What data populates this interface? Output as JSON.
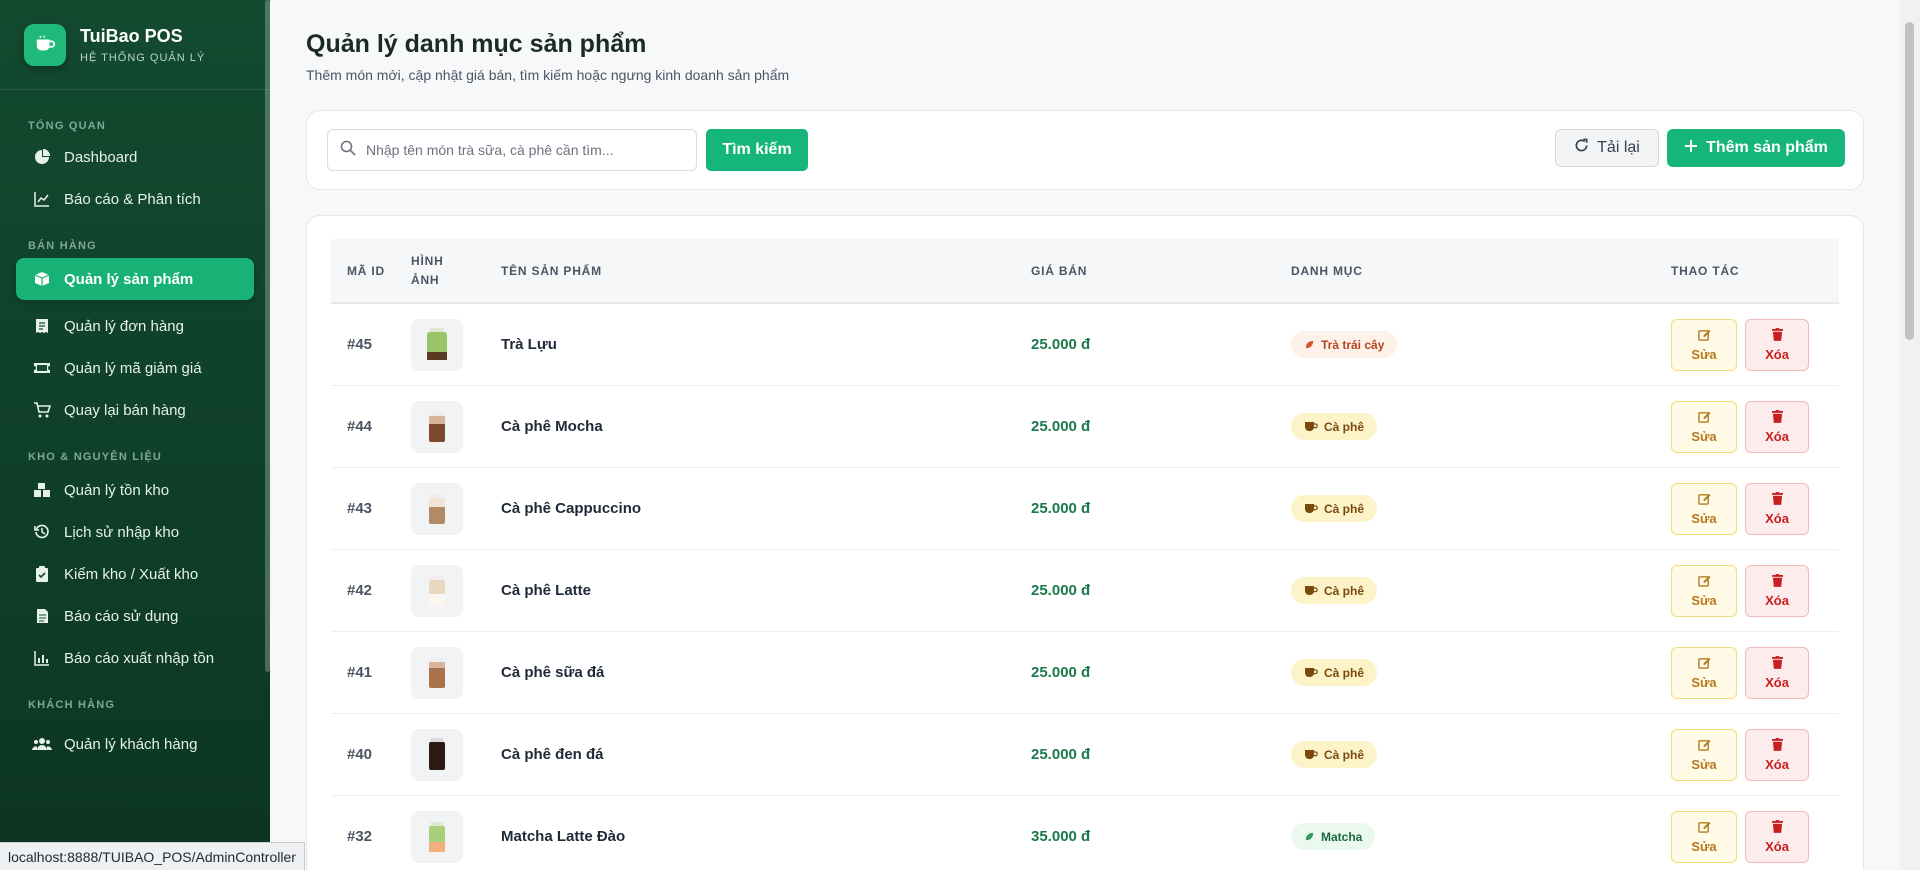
{
  "brand": {
    "name": "TuiBao POS",
    "subtitle": "HỆ THỐNG QUẢN LÝ"
  },
  "sidebar": {
    "sections": [
      {
        "title": "TỔNG QUAN",
        "items": [
          {
            "label": "Dashboard",
            "icon": "chart-pie-icon"
          },
          {
            "label": "Báo cáo & Phân tích",
            "icon": "chart-line-icon"
          }
        ]
      },
      {
        "title": "BÁN HÀNG",
        "items": [
          {
            "label": "Quản lý sản phẩm",
            "icon": "box-icon",
            "active": true
          },
          {
            "label": "Quản lý đơn hàng",
            "icon": "receipt-icon"
          },
          {
            "label": "Quản lý mã giảm giá",
            "icon": "ticket-icon"
          },
          {
            "label": "Quay lại bán hàng",
            "icon": "cart-icon"
          }
        ]
      },
      {
        "title": "KHO & NGUYÊN LIỆU",
        "items": [
          {
            "label": "Quản lý tồn kho",
            "icon": "boxes-icon"
          },
          {
            "label": "Lịch sử nhập kho",
            "icon": "history-icon"
          },
          {
            "label": "Kiểm kho / Xuất kho",
            "icon": "clipboard-check-icon"
          },
          {
            "label": "Báo cáo sử dụng",
            "icon": "file-icon"
          },
          {
            "label": "Báo cáo xuất nhập tồn",
            "icon": "bar-chart-icon"
          }
        ]
      },
      {
        "title": "KHÁCH HÀNG",
        "items": [
          {
            "label": "Quản lý khách hàng",
            "icon": "users-icon"
          }
        ]
      }
    ]
  },
  "page": {
    "title": "Quản lý danh mục sản phẩm",
    "subtitle": "Thêm món mới, cập nhật giá bán, tìm kiếm hoặc ngưng kinh doanh sản phẩm"
  },
  "toolbar": {
    "search_placeholder": "Nhập tên món trà sữa, cà phê cần tìm...",
    "search_value": "",
    "search_button": "Tìm kiếm",
    "reload_button": "Tải lại",
    "add_button": "Thêm sản phẩm"
  },
  "table": {
    "headers": {
      "id": "MÃ ID",
      "image_line1": "HÌNH",
      "image_line2": "ẢNH",
      "name": "TÊN SẢN PHẨM",
      "price": "GIÁ BÁN",
      "category": "DANH MỤC",
      "actions": "THAO TÁC"
    },
    "edit_label": "Sửa",
    "delete_label": "Xóa",
    "rows": [
      {
        "id": "#45",
        "name": "Trà Lựu",
        "price": "25.000 đ",
        "category": "Trà trái cây",
        "cat_type": "fruit",
        "drink": "green"
      },
      {
        "id": "#44",
        "name": "Cà phê Mocha",
        "price": "25.000 đ",
        "category": "Cà phê",
        "cat_type": "coffee",
        "drink": "mocha"
      },
      {
        "id": "#43",
        "name": "Cà phê Cappuccino",
        "price": "25.000 đ",
        "category": "Cà phê",
        "cat_type": "coffee",
        "drink": "cappuccino"
      },
      {
        "id": "#42",
        "name": "Cà phê Latte",
        "price": "25.000 đ",
        "category": "Cà phê",
        "cat_type": "coffee",
        "drink": "latte"
      },
      {
        "id": "#41",
        "name": "Cà phê sữa đá",
        "price": "25.000 đ",
        "category": "Cà phê",
        "cat_type": "coffee",
        "drink": "milkcoffee"
      },
      {
        "id": "#40",
        "name": "Cà phê đen đá",
        "price": "25.000 đ",
        "category": "Cà phê",
        "cat_type": "coffee",
        "drink": "black"
      },
      {
        "id": "#32",
        "name": "Matcha Latte Đào",
        "price": "35.000 đ",
        "category": "Matcha",
        "cat_type": "matcha",
        "drink": "matcha"
      }
    ]
  },
  "status_url": "localhost:8888/TUIBAO_POS/AdminController",
  "colors": {
    "sidebar_bg": "#134a30",
    "accent": "#16b57a",
    "price": "#1a7a4c"
  }
}
